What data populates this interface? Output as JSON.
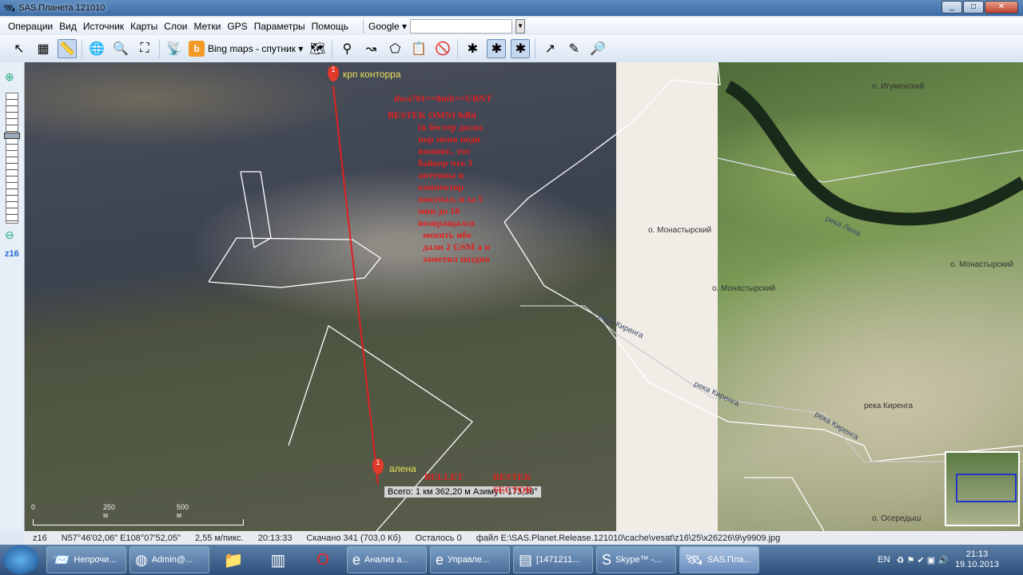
{
  "window": {
    "title": "SAS.Планета 121010",
    "min": "_",
    "max": "□",
    "close": "✕"
  },
  "menu": [
    "Операции",
    "Вид",
    "Источник",
    "Карты",
    "Слои",
    "Метки",
    "GPS",
    "Параметры",
    "Помощь"
  ],
  "search": {
    "provider": "Google ▾",
    "value": ""
  },
  "toolbar": {
    "map_source": "Bing maps - спутник ▾"
  },
  "zoom": {
    "level": "z16"
  },
  "map": {
    "markers": [
      {
        "num": "1",
        "label": "крп конторра"
      },
      {
        "num": "1",
        "label": "алена"
      }
    ],
    "note_lines": [
      "dwa701==8mb==UBNT",
      "BESTEK OMNI 8dbi",
      "(в бестер   досих",
      "пор меня поди",
      "помнят.. тот",
      "байкер что 3",
      "антенны и",
      "коннектор",
      "покупал, и за 5",
      "мин до 18",
      "возвращался",
      "менять  ибо",
      "дали 2 GSM а я",
      "заметил поздно"
    ],
    "note2": [
      "BULLET",
      "BESTEK",
      "SECTOR"
    ],
    "distance": "Всего: 1 км 362,20 м Азимут: 173,38°",
    "scale": [
      "0",
      "250 м",
      "500 м"
    ],
    "places": [
      "о. Игуменский",
      "о. Монастырский",
      "о. Монастырский",
      "о. Монастырский",
      "о. Осередыш"
    ],
    "rivers": [
      "река Лена",
      "река Киренга",
      "река Киренга",
      "река Киренга",
      "река Киренга"
    ]
  },
  "status": {
    "zoom": "z16",
    "coords": "N57°46'02,06\" E108°07'52,05\"",
    "resolution": "2,55 м/пикс.",
    "time": "20:13:33",
    "downloaded": "Скачано 341 (703,0 Кб)",
    "remaining": "Осталось 0",
    "file": "файл E:\\SAS.Planet.Release.121010\\cache\\vesat\\z16\\25\\x26226\\9\\y9909.jpg"
  },
  "taskbar": {
    "items": [
      "Непрочи...",
      "Admin@...",
      "Анализ а...",
      "Управле...",
      "[1471211...",
      "Skype™ -...",
      "SAS.Пла..."
    ],
    "lang": "EN",
    "time": "21:13",
    "date": "19.10.2013"
  }
}
